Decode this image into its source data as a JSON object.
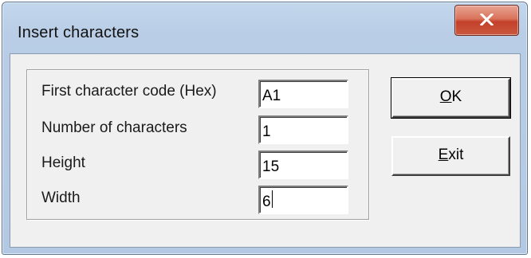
{
  "window": {
    "title": "Insert characters"
  },
  "fields": [
    {
      "label": "First character code (Hex)",
      "value": "A1"
    },
    {
      "label": "Number of characters",
      "value": "1"
    },
    {
      "label": "Height",
      "value": "15"
    },
    {
      "label": "Width",
      "value": "6"
    }
  ],
  "buttons": {
    "ok": {
      "mnemonic": "O",
      "rest": "K"
    },
    "exit": {
      "mnemonic": "E",
      "rest": "xit"
    }
  },
  "icons": {
    "close": "close-icon"
  },
  "colors": {
    "close_button": "#c94a32",
    "dialog_face": "#f0f0f0",
    "title_bar": "#bcd0e8"
  }
}
